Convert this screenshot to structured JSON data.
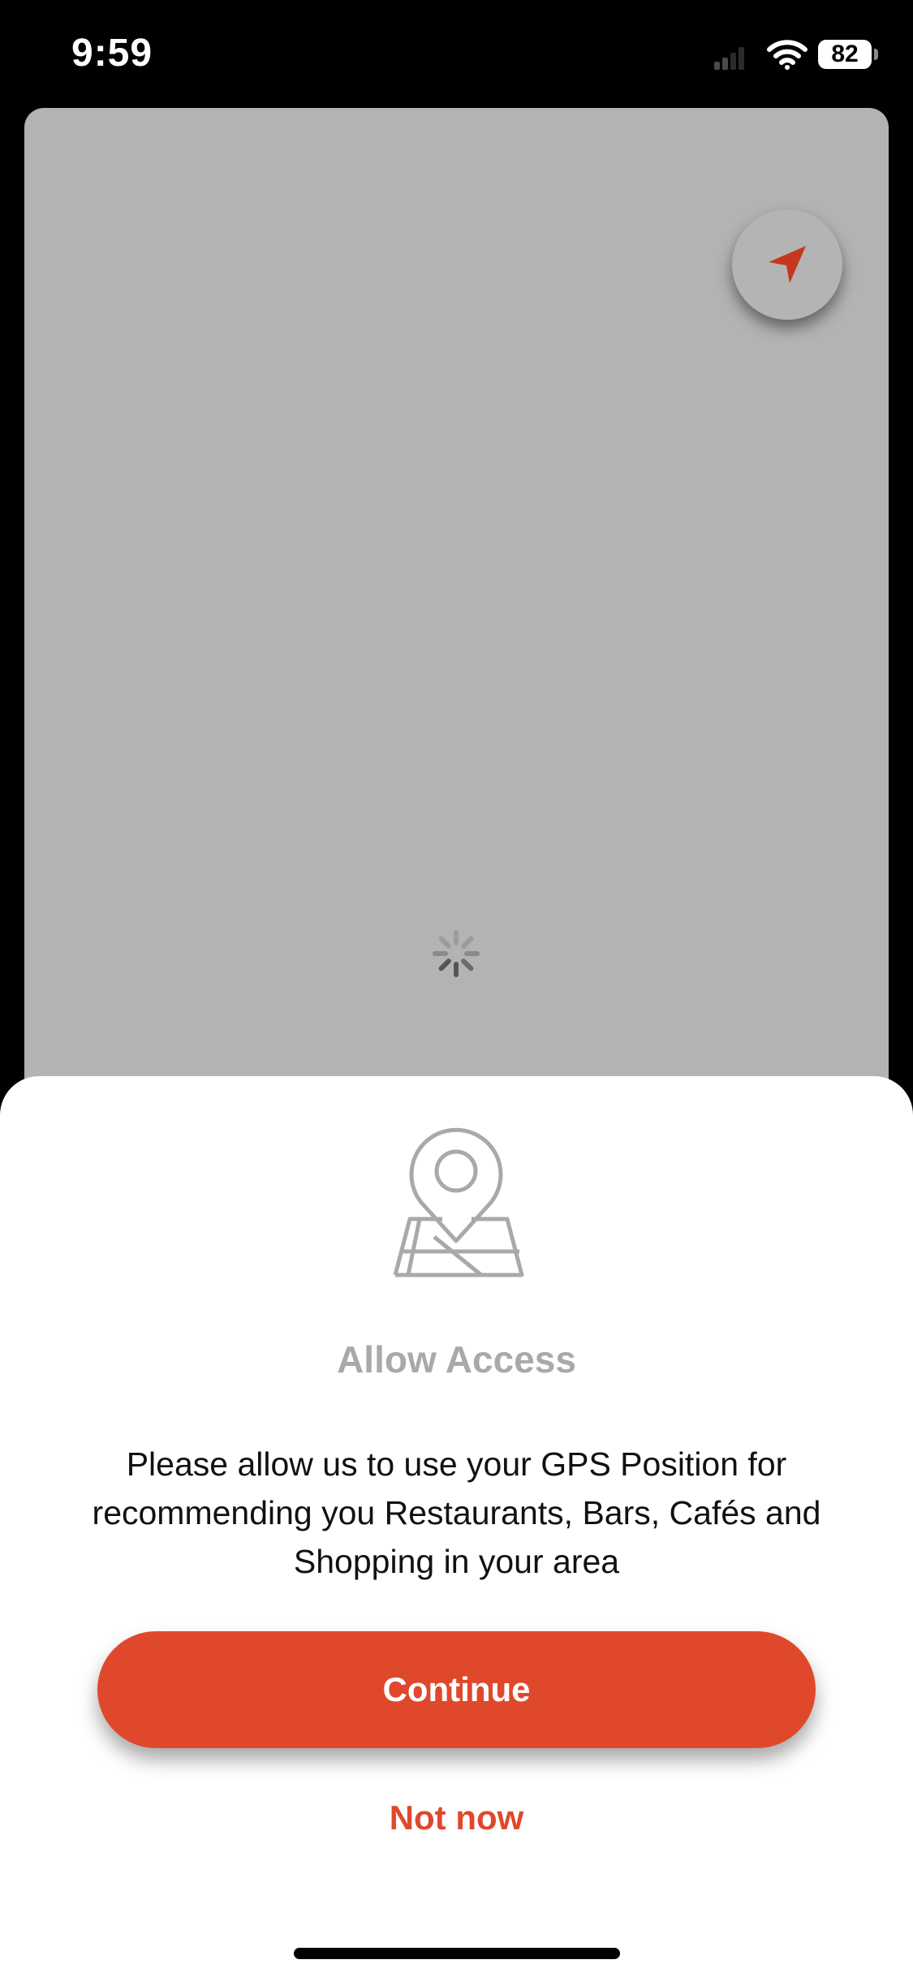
{
  "status_bar": {
    "time": "9:59",
    "battery": "82",
    "icons": [
      "signal-icon",
      "wifi-icon",
      "battery-icon"
    ]
  },
  "map": {
    "locate_button_icon": "navigation-arrow-icon",
    "loading_icon": "loading-spinner-icon",
    "locate_icon_color": "#c4391e",
    "background_color": "#b3b3b3"
  },
  "sheet": {
    "icon": "map-pin-icon",
    "title": "Allow Access",
    "message": "Please allow us to use your GPS Position for recommending you Restaurants, Bars, Cafés and Shopping in your area",
    "continue_label": "Continue",
    "not_now_label": "Not now"
  },
  "colors": {
    "accent": "#e0482c",
    "title_gray": "#a9a9a9"
  }
}
